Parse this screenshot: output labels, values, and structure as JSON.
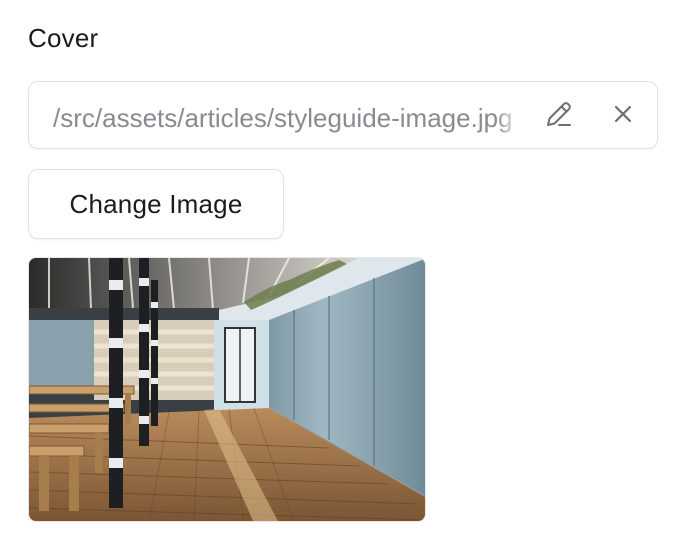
{
  "cover": {
    "label": "Cover",
    "path_value": "/src/assets/articles/styleguide-image.jpg",
    "edit_icon": "pencil-icon",
    "clear_icon": "close-icon",
    "change_button_label": "Change Image",
    "preview_image": "covered-walkway-photo"
  }
}
